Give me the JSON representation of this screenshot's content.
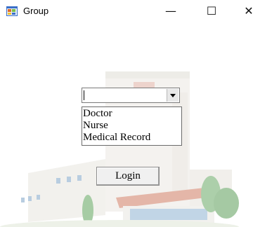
{
  "window": {
    "title": "Group",
    "minimize_glyph": "—",
    "maximize_glyph": "☐",
    "close_glyph": "✕"
  },
  "role_select": {
    "selected_value": ""
  },
  "dropdown": {
    "options": [
      "Doctor",
      "Nurse",
      "Medical Record"
    ]
  },
  "login_button": {
    "label": "Login"
  },
  "icons": {
    "app": "app-window-icon",
    "dropdown": "chevron-down-icon"
  },
  "colors": {
    "building_wall": "#e9e6df",
    "roof_red": "#c8745a",
    "tree_green": "#4f9a4f"
  }
}
